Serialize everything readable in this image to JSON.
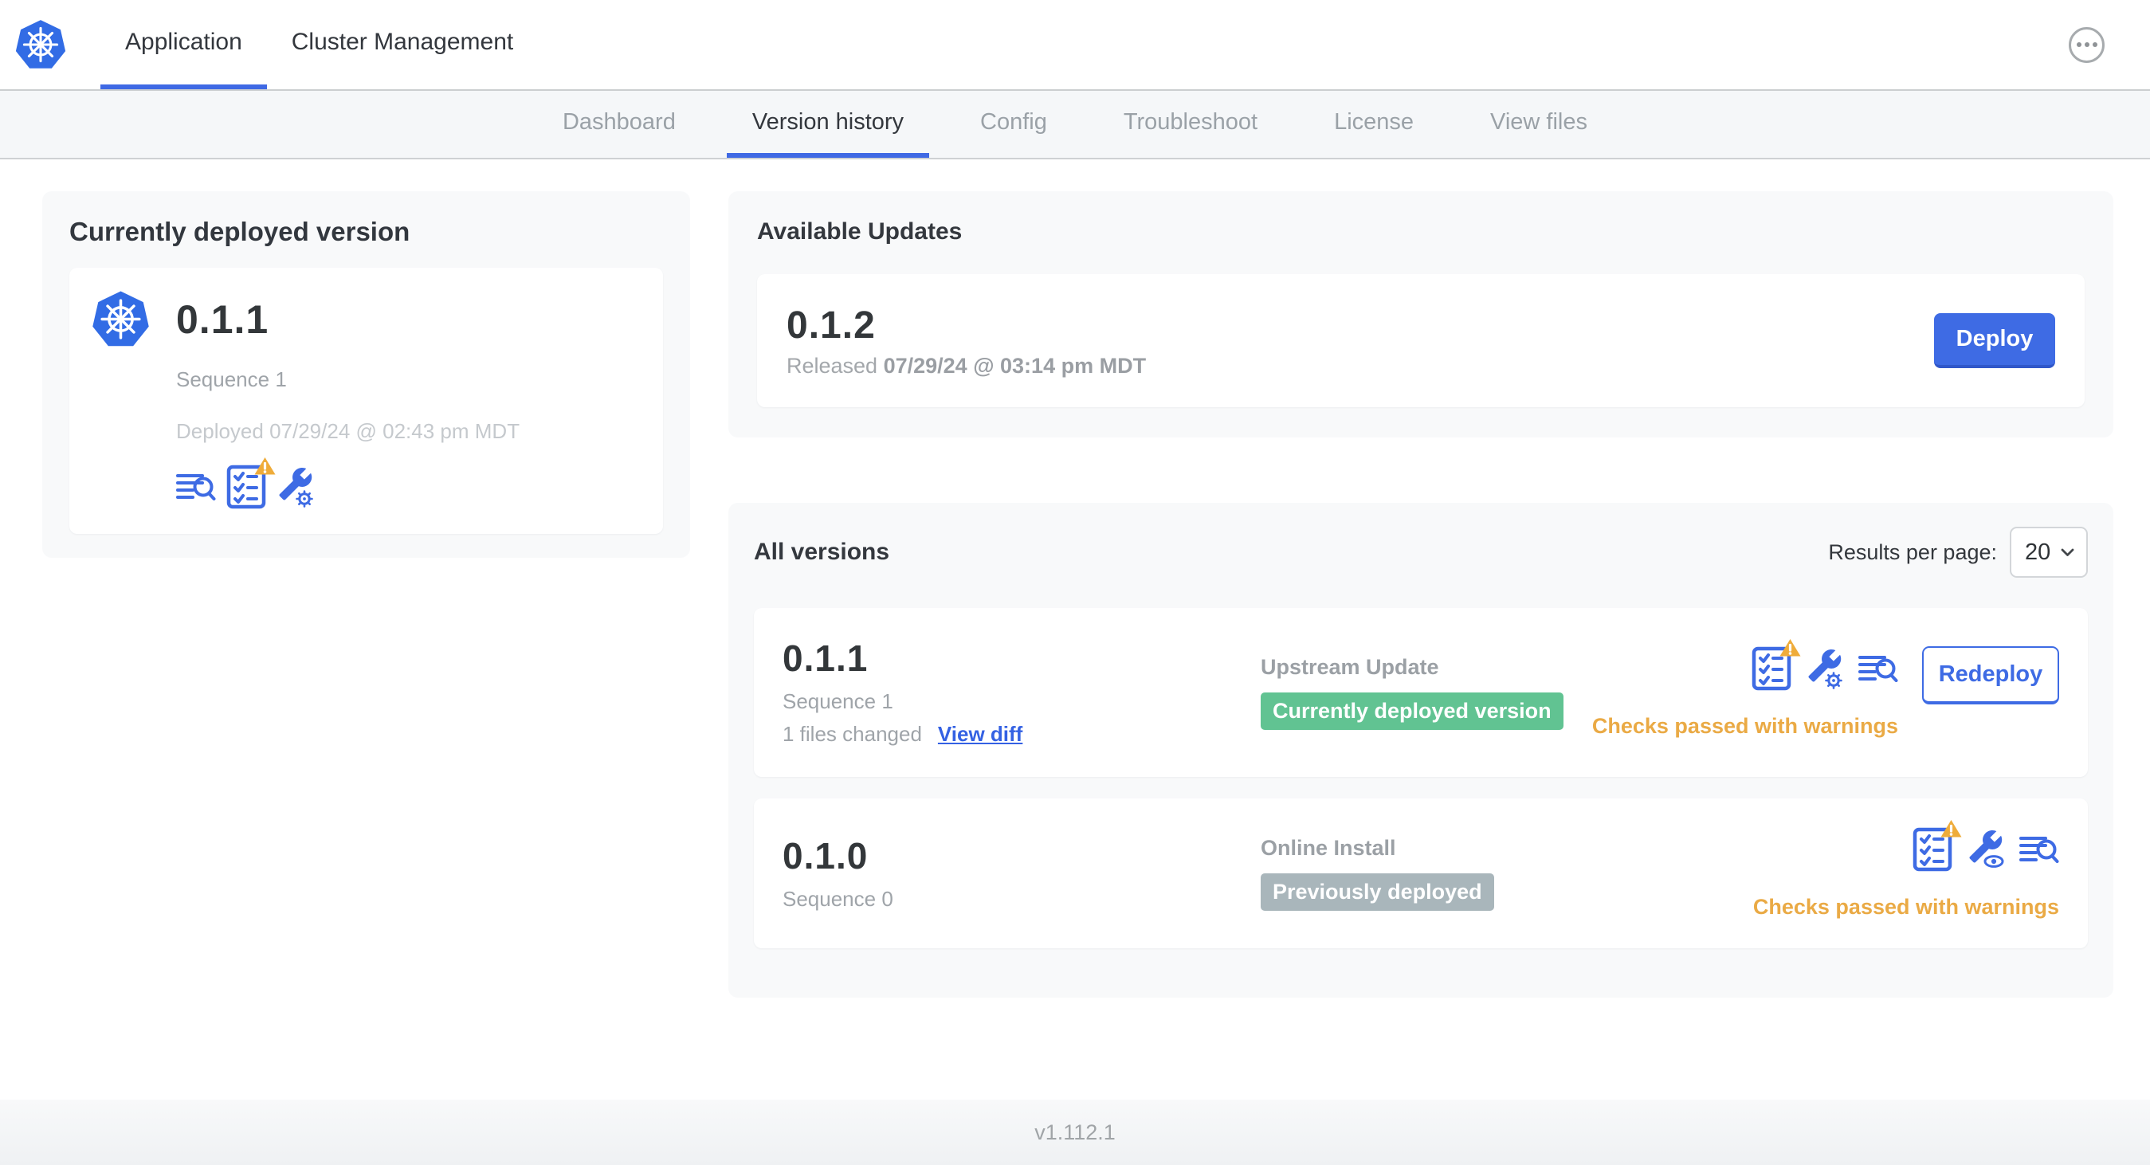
{
  "topbar": {
    "tabs": [
      {
        "label": "Application",
        "active": true
      },
      {
        "label": "Cluster Management",
        "active": false
      }
    ]
  },
  "subnav": {
    "tabs": [
      {
        "label": "Dashboard",
        "active": false
      },
      {
        "label": "Version history",
        "active": true
      },
      {
        "label": "Config",
        "active": false
      },
      {
        "label": "Troubleshoot",
        "active": false
      },
      {
        "label": "License",
        "active": false
      },
      {
        "label": "View files",
        "active": false
      }
    ]
  },
  "current_version": {
    "title": "Currently deployed version",
    "version": "0.1.1",
    "sequence": "Sequence 1",
    "deployed": "Deployed 07/29/24 @ 02:43 pm MDT",
    "icons": [
      "deploy-logs-icon",
      "preflight-checks-warning-icon",
      "edit-config-icon"
    ]
  },
  "available_updates": {
    "title": "Available Updates",
    "version": "0.1.2",
    "released_prefix": "Released",
    "released_date": "07/29/24 @ 03:14 pm MDT",
    "deploy_label": "Deploy"
  },
  "all_versions": {
    "title": "All versions",
    "results_per_page_label": "Results per page:",
    "results_per_page_value": "20",
    "rows": [
      {
        "version": "0.1.1",
        "sequence": "Sequence 1",
        "files_changed": "1 files changed",
        "view_diff_label": "View diff",
        "source": "Upstream Update",
        "badge": "Currently deployed version",
        "badge_color": "#61C392",
        "checks": "Checks passed with warnings",
        "action_label": "Redeploy",
        "icons": [
          "preflight-checks-warning-icon",
          "edit-config-icon",
          "deploy-logs-icon"
        ]
      },
      {
        "version": "0.1.0",
        "sequence": "Sequence 0",
        "source": "Online Install",
        "badge": "Previously deployed",
        "badge_color": "#A9B6BB",
        "checks": "Checks passed with warnings",
        "icons": [
          "preflight-checks-warning-icon",
          "view-config-icon",
          "deploy-logs-icon"
        ]
      }
    ]
  },
  "footer": {
    "version": "v1.112.1"
  },
  "colors": {
    "accent_blue": "#3E6BE4",
    "kubernetes_blue": "#326CE5",
    "badge_green": "#61C392",
    "badge_gray": "#A9B6BB",
    "warning_amber_text": "#EAAA45",
    "warning_triangle": "#EFAC3A",
    "subnav_bg": "#f5f7f9",
    "card_bg": "#f8f9fa"
  },
  "icons": {
    "app_logo": "kubernetes-helm-wheel",
    "top_right": "ellipsis-circle",
    "select_chevron": "chevron-down"
  }
}
